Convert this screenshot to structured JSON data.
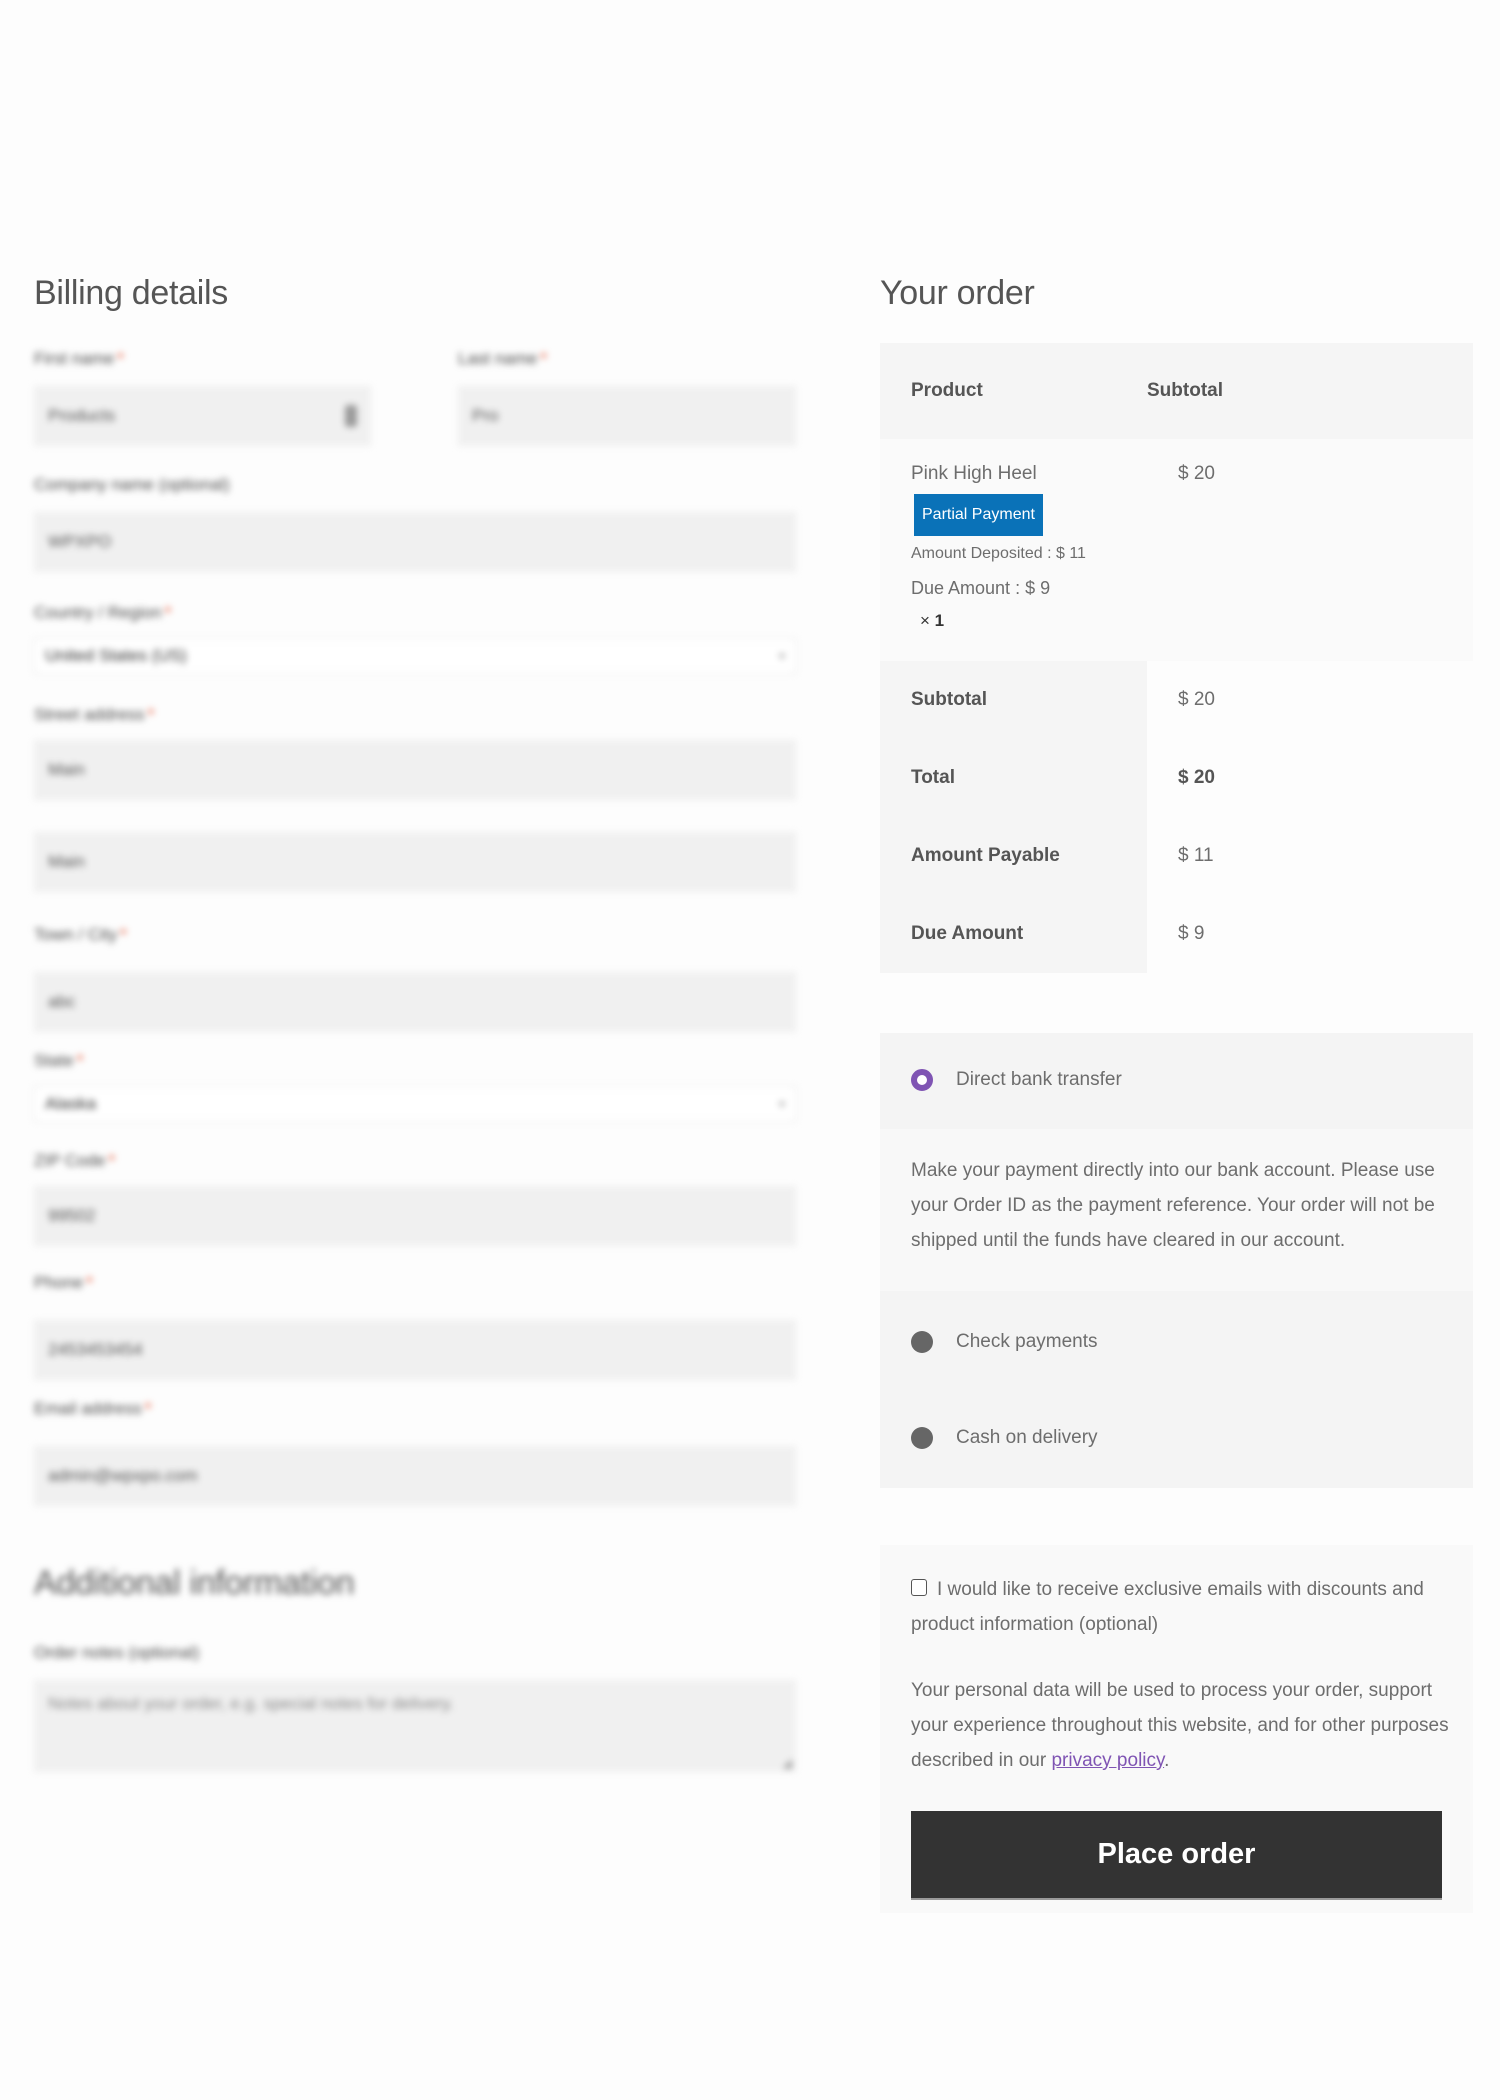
{
  "billing": {
    "title": "Billing details",
    "fields": {
      "first_name": {
        "label": "First name",
        "value": "Products"
      },
      "last_name": {
        "label": "Last name",
        "value": "Pro"
      },
      "company": {
        "label": "Company name (optional)",
        "value": "WPXPO"
      },
      "country": {
        "label": "Country / Region",
        "value": "United States (US)"
      },
      "street": {
        "label": "Street address",
        "value_1": "Main",
        "value_2": "Main"
      },
      "city": {
        "label": "Town / City",
        "value": "abc"
      },
      "state": {
        "label": "State",
        "value": "Alaska"
      },
      "zip": {
        "label": "ZIP Code",
        "value": "99502"
      },
      "phone": {
        "label": "Phone",
        "value": "2453453454"
      },
      "email": {
        "label": "Email address",
        "value": "admin@wpxpo.com"
      }
    },
    "required_mark": "*"
  },
  "additional": {
    "title": "Additional information",
    "notes_label": "Order notes (optional)",
    "notes_placeholder": "Notes about your order, e.g. special notes for delivery."
  },
  "order": {
    "title": "Your order",
    "headers": {
      "product": "Product",
      "subtotal": "Subtotal"
    },
    "item": {
      "name": "Pink High Heel",
      "subtotal": "$ 20",
      "badge": "Partial Payment",
      "deposited": "Amount Deposited : $ 11",
      "due": "Due Amount : $ 9",
      "qty_symbol": "×",
      "qty": "1"
    },
    "totals": [
      {
        "label": "Subtotal",
        "value": "$ 20"
      },
      {
        "label": "Total",
        "value": "$ 20"
      },
      {
        "label": "Amount Payable",
        "value": "$ 11"
      },
      {
        "label": "Due Amount",
        "value": "$ 9"
      }
    ]
  },
  "payment": {
    "methods": [
      {
        "label": "Direct bank transfer",
        "selected": true
      },
      {
        "label": "Check payments",
        "selected": false
      },
      {
        "label": "Cash on delivery",
        "selected": false
      }
    ],
    "bank_description": "Make your payment directly into our bank account. Please use your Order ID as the payment reference. Your order will not be shipped until the funds have cleared in our account."
  },
  "terms": {
    "newsletter_label": "I would like to receive exclusive emails with discounts and product information (optional)",
    "newsletter_checked": false,
    "privacy_text_before": "Your personal data will be used to process your order, support your experience throughout this website, and for other purposes described in our ",
    "privacy_link": "privacy policy",
    "privacy_text_after": ".",
    "place_order": "Place order"
  },
  "colors": {
    "badge": "#0a72b8",
    "accent_radio": "#7f54b3",
    "button": "#333333"
  }
}
